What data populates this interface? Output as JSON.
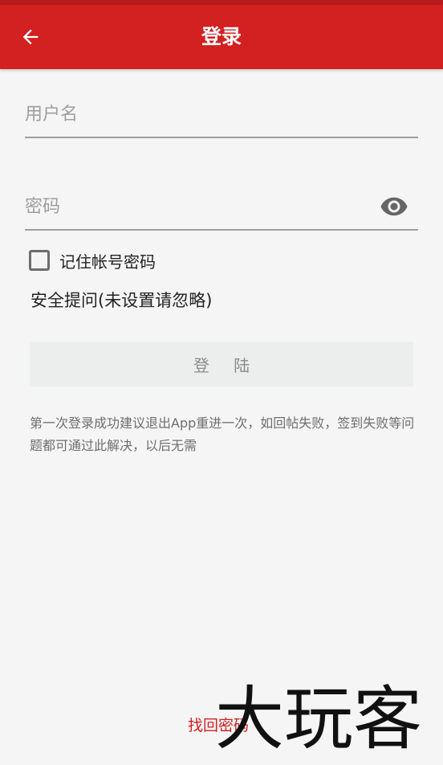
{
  "appbar": {
    "title": "登录",
    "back_icon": "arrow-left-icon",
    "background_color": "#d32020"
  },
  "form": {
    "username_placeholder": "用户名",
    "username_value": "",
    "password_placeholder": "密码",
    "password_value": "",
    "visibility_icon": "eye-icon",
    "remember_label": "记住帐号密码",
    "remember_checked": false,
    "security_question_label": "安全提问(未设置请忽略)",
    "login_button_label": "登 陆"
  },
  "hint": "第一次登录成功建议退出App重进一次，如回帖失败，签到失败等问题都可通过此解决，以后无需",
  "recover_password_label": "找回密码",
  "watermark_text": "大玩客",
  "colors": {
    "accent": "#d32020",
    "background": "#f5f5f5",
    "button_disabled": "#eceeed"
  }
}
